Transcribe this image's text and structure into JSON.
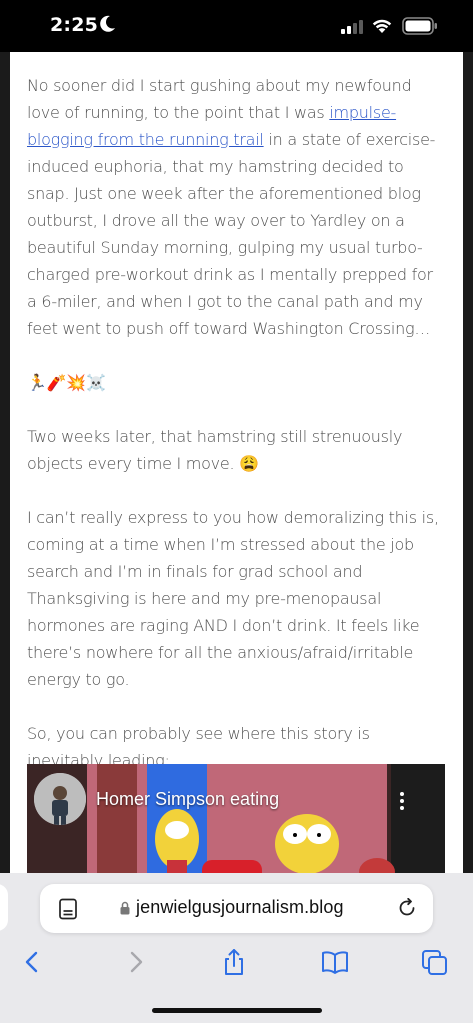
{
  "status_bar": {
    "time": "2:25"
  },
  "article": {
    "paragraphs": [
      {
        "before_link": "No sooner did I start gushing about my newfound love of running, to the point that I was ",
        "link_text": "impulse-blogging from the running trail",
        "after_link": " in a state of exercise-induced euphoria, that my hamstring decided to snap. Just one week after the aforementioned blog outburst, I drove all the way over to Yardley on a beautiful Sunday morning, gulping my usual turbo-charged pre-workout drink as I mentally prepped for a 6-miler, and when I got to the canal path and my feet went to push off toward Washington Crossing…"
      },
      {
        "text": "🏃🧨💥☠️"
      },
      {
        "text": "Two weeks later, that hamstring still strenuously objects every time I move. 😩"
      },
      {
        "text": "I can’t really express to you how demoralizing this is, coming at a time when I’m stressed about the job search and I’m in finals for grad school and Thanksgiving is here and my pre-menopausal hormones are raging AND I don’t drink. It feels like there’s nowhere for all the anxious/afraid/irritable energy to go."
      },
      {
        "text": "So, you can probably see where this story is inevitably leading:"
      }
    ]
  },
  "video": {
    "title": "Homer Simpson eating"
  },
  "browser": {
    "url": "jenwielgusjournalism.blog"
  },
  "icons": {
    "moon": "moon-icon",
    "signal": "cellular-signal-icon",
    "wifi": "wifi-icon",
    "battery": "battery-icon",
    "reader": "reader-mode-icon",
    "lock": "lock-icon",
    "reload": "reload-icon",
    "back": "back-chevron-icon",
    "forward": "forward-chevron-icon",
    "share": "share-icon",
    "bookmarks": "bookmarks-icon",
    "tabs": "tabs-icon"
  },
  "colors": {
    "accent": "#2f6fe4",
    "link": "#2a55c8",
    "body_text": "#4f4f4f"
  }
}
